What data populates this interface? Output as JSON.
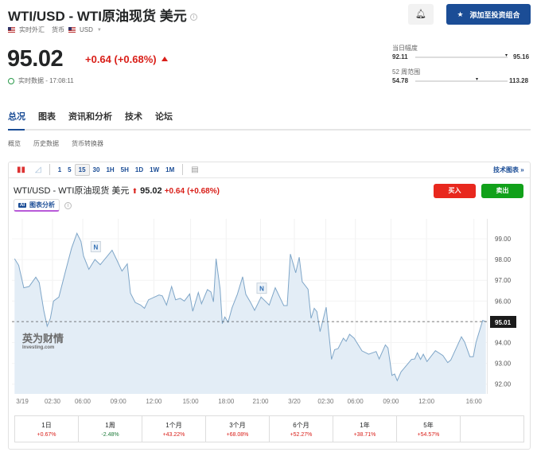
{
  "header": {
    "title": "WTI/USD - WTI原油现货 美元",
    "info_icon": "i",
    "market": "实时外汇",
    "currency_label": "货币",
    "currency": "USD",
    "price": "95.02",
    "change": "+0.64 (+0.68%)",
    "status": "实时数据 - 17:08:11"
  },
  "actions": {
    "bell_icon": "bell-plus-icon",
    "add_portfolio": "添加至投资组合"
  },
  "ranges": {
    "day_label": "当日幅度",
    "day_low": "92.11",
    "day_high": "95.16",
    "day_position": 0.98,
    "week52_label": "52 周范围",
    "week52_low": "54.78",
    "week52_high": "113.28",
    "week52_position": 0.69
  },
  "tabs": [
    {
      "label": "总况",
      "active": true
    },
    {
      "label": "图表"
    },
    {
      "label": "资讯和分析"
    },
    {
      "label": "技术"
    },
    {
      "label": "论坛"
    }
  ],
  "subtabs": [
    "概览",
    "历史数据",
    "货币转换器"
  ],
  "chart_toolbar": {
    "intervals": [
      "1",
      "5",
      "15",
      "30",
      "1H",
      "5H",
      "1D",
      "1W",
      "1M"
    ],
    "selected": "15",
    "tech_chart": "技术图表 »"
  },
  "chart_header": {
    "title": "WTI/USD - WTI原油现货 美元",
    "price": "95.02",
    "change": "+0.64",
    "change_pct": "(+0.68%)",
    "buy": "买入",
    "sell": "卖出",
    "ai_badge": "AI",
    "ai_label": "图表分析"
  },
  "watermark": {
    "cn": "英为财情",
    "en": "Investing.com"
  },
  "colors": {
    "up": "#d91e18",
    "down": "#1e7b3a",
    "buy": "#e8281e",
    "sell": "#11a11a",
    "brand": "#1b4d96",
    "line": "#7fa6c8",
    "fill": "#e3edf6"
  },
  "chart_data": {
    "type": "area",
    "title": "WTI/USD 15-minute",
    "ylim": [
      91.5,
      100.0
    ],
    "y_ticks": [
      "92.00",
      "93.00",
      "94.00",
      "95.00",
      "96.00",
      "97.00",
      "98.00",
      "99.00"
    ],
    "y_tick_values": [
      92,
      93,
      94,
      96,
      97,
      98,
      99
    ],
    "current_price": 95.01,
    "current_label": "95.01",
    "x_unit": "hours since 3/19 00:00",
    "x_ticks": [
      {
        "label": "3/19",
        "h": 0
      },
      {
        "label": "02:30",
        "h": 2.55
      },
      {
        "label": "06:00",
        "h": 5.1
      },
      {
        "label": "09:00",
        "h": 8.1
      },
      {
        "label": "12:00",
        "h": 11.1
      },
      {
        "label": "15:00",
        "h": 14.2
      },
      {
        "label": "18:00",
        "h": 17.2
      },
      {
        "label": "21:00",
        "h": 20.1
      },
      {
        "label": "3/20",
        "h": 22.95
      },
      {
        "label": "02:30",
        "h": 25.6
      },
      {
        "label": "06:00",
        "h": 28.1
      },
      {
        "label": "09:00",
        "h": 31.1
      },
      {
        "label": "12:00",
        "h": 34.1
      },
      {
        "label": "16:00",
        "h": 38.1
      }
    ],
    "news_markers": [
      {
        "label": "N",
        "h": 6.2,
        "price": 98.6
      },
      {
        "label": "N",
        "h": 20.2,
        "price": 96.6
      }
    ],
    "points": [
      [
        -0.65,
        98.04
      ],
      [
        -0.3,
        97.72
      ],
      [
        0.13,
        96.64
      ],
      [
        0.58,
        96.7
      ],
      [
        1.14,
        97.15
      ],
      [
        1.43,
        96.89
      ],
      [
        1.81,
        95.55
      ],
      [
        2.1,
        94.79
      ],
      [
        2.37,
        95.17
      ],
      [
        2.64,
        96.0
      ],
      [
        3.09,
        96.19
      ],
      [
        3.67,
        97.49
      ],
      [
        4.16,
        98.55
      ],
      [
        4.61,
        99.26
      ],
      [
        4.95,
        98.87
      ],
      [
        5.17,
        98.17
      ],
      [
        5.62,
        97.53
      ],
      [
        6.13,
        98.0
      ],
      [
        6.58,
        97.75
      ],
      [
        7.18,
        98.17
      ],
      [
        7.58,
        98.45
      ],
      [
        7.97,
        97.98
      ],
      [
        8.41,
        97.44
      ],
      [
        8.86,
        97.79
      ],
      [
        9.13,
        96.38
      ],
      [
        9.53,
        95.93
      ],
      [
        9.98,
        95.81
      ],
      [
        10.31,
        95.65
      ],
      [
        10.65,
        96.06
      ],
      [
        11.54,
        96.29
      ],
      [
        11.81,
        96.25
      ],
      [
        12.17,
        95.81
      ],
      [
        12.6,
        96.7
      ],
      [
        12.93,
        96.06
      ],
      [
        13.33,
        96.13
      ],
      [
        13.67,
        96.0
      ],
      [
        14.12,
        96.34
      ],
      [
        14.38,
        95.51
      ],
      [
        14.85,
        96.41
      ],
      [
        15.12,
        95.87
      ],
      [
        15.62,
        96.55
      ],
      [
        15.91,
        96.44
      ],
      [
        16.13,
        95.96
      ],
      [
        16.35,
        98.04
      ],
      [
        16.69,
        96.57
      ],
      [
        16.87,
        94.91
      ],
      [
        17.09,
        95.23
      ],
      [
        17.36,
        94.98
      ],
      [
        17.7,
        95.68
      ],
      [
        18.14,
        96.32
      ],
      [
        18.59,
        97.17
      ],
      [
        18.86,
        96.32
      ],
      [
        19.26,
        95.93
      ],
      [
        19.6,
        95.55
      ],
      [
        20.15,
        96.19
      ],
      [
        20.83,
        95.81
      ],
      [
        21.34,
        96.64
      ],
      [
        21.72,
        96.19
      ],
      [
        22.06,
        95.78
      ],
      [
        22.35,
        95.78
      ],
      [
        22.62,
        98.26
      ],
      [
        23.07,
        97.36
      ],
      [
        23.36,
        98.11
      ],
      [
        23.62,
        96.93
      ],
      [
        24.11,
        96.57
      ],
      [
        24.36,
        95.17
      ],
      [
        24.63,
        95.65
      ],
      [
        24.85,
        95.49
      ],
      [
        25.12,
        94.53
      ],
      [
        25.64,
        95.7
      ],
      [
        26.09,
        93.19
      ],
      [
        26.35,
        93.66
      ],
      [
        26.64,
        93.71
      ],
      [
        27.09,
        94.21
      ],
      [
        27.32,
        94.06
      ],
      [
        27.61,
        94.4
      ],
      [
        27.99,
        94.21
      ],
      [
        28.66,
        93.6
      ],
      [
        29.22,
        93.44
      ],
      [
        29.85,
        93.57
      ],
      [
        30.11,
        93.21
      ],
      [
        30.63,
        93.89
      ],
      [
        30.85,
        93.74
      ],
      [
        31.19,
        92.42
      ],
      [
        31.41,
        92.49
      ],
      [
        31.63,
        92.17
      ],
      [
        31.95,
        92.59
      ],
      [
        32.84,
        93.19
      ],
      [
        33.11,
        93.21
      ],
      [
        33.33,
        93.51
      ],
      [
        33.6,
        93.19
      ],
      [
        33.83,
        93.44
      ],
      [
        34.14,
        93.09
      ],
      [
        34.85,
        93.61
      ],
      [
        35.48,
        93.38
      ],
      [
        35.89,
        93.04
      ],
      [
        36.15,
        93.16
      ],
      [
        37.05,
        94.28
      ],
      [
        37.32,
        94.02
      ],
      [
        37.76,
        93.32
      ],
      [
        38.05,
        93.32
      ],
      [
        38.28,
        94.02
      ],
      [
        38.84,
        95.07
      ],
      [
        39.11,
        95.01
      ]
    ]
  },
  "performance": [
    {
      "period": "1日",
      "value": "+0.67%",
      "dir": "up"
    },
    {
      "period": "1周",
      "value": "-2.48%",
      "dir": "down"
    },
    {
      "period": "1个月",
      "value": "+43.22%",
      "dir": "up"
    },
    {
      "period": "3个月",
      "value": "+68.08%",
      "dir": "up"
    },
    {
      "period": "6个月",
      "value": "+52.27%",
      "dir": "up"
    },
    {
      "period": "1年",
      "value": "+38.71%",
      "dir": "up"
    },
    {
      "period": "5年",
      "value": "+54.57%",
      "dir": "up"
    }
  ]
}
